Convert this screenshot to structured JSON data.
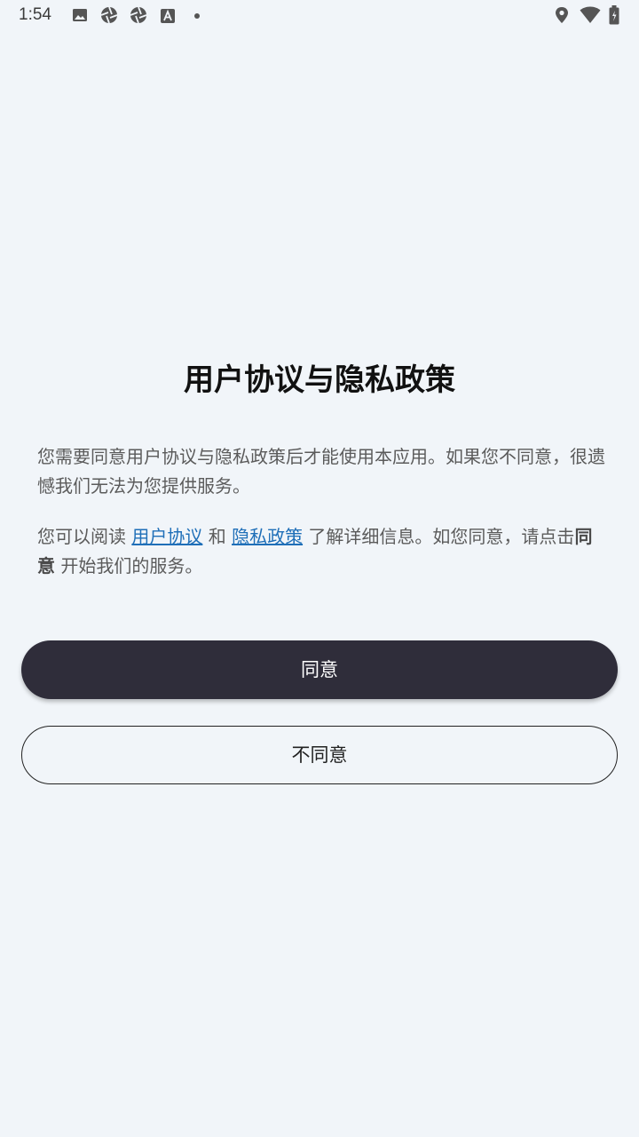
{
  "status_bar": {
    "time": "1:54",
    "left_icons": [
      "image-icon",
      "aperture-icon",
      "aperture-icon",
      "font-a-icon",
      "dot-icon"
    ],
    "right_icons": [
      "location-icon",
      "wifi-icon",
      "battery-icon"
    ]
  },
  "dialog": {
    "title": "用户协议与隐私政策",
    "para1": "您需要同意用户协议与隐私政策后才能使用本应用。如果您不同意，很遗憾我们无法为您提供服务。",
    "para2": {
      "prefix": "您可以阅读 ",
      "link_user_agreement": "用户协议",
      "conjunction": " 和 ",
      "link_privacy_policy": "隐私政策",
      "middle": " 了解详细信息。如您同意，请点击",
      "bold_agree": "同意",
      "suffix": " 开始我们的服务。"
    },
    "agree_button": "同意",
    "disagree_button": "不同意"
  }
}
